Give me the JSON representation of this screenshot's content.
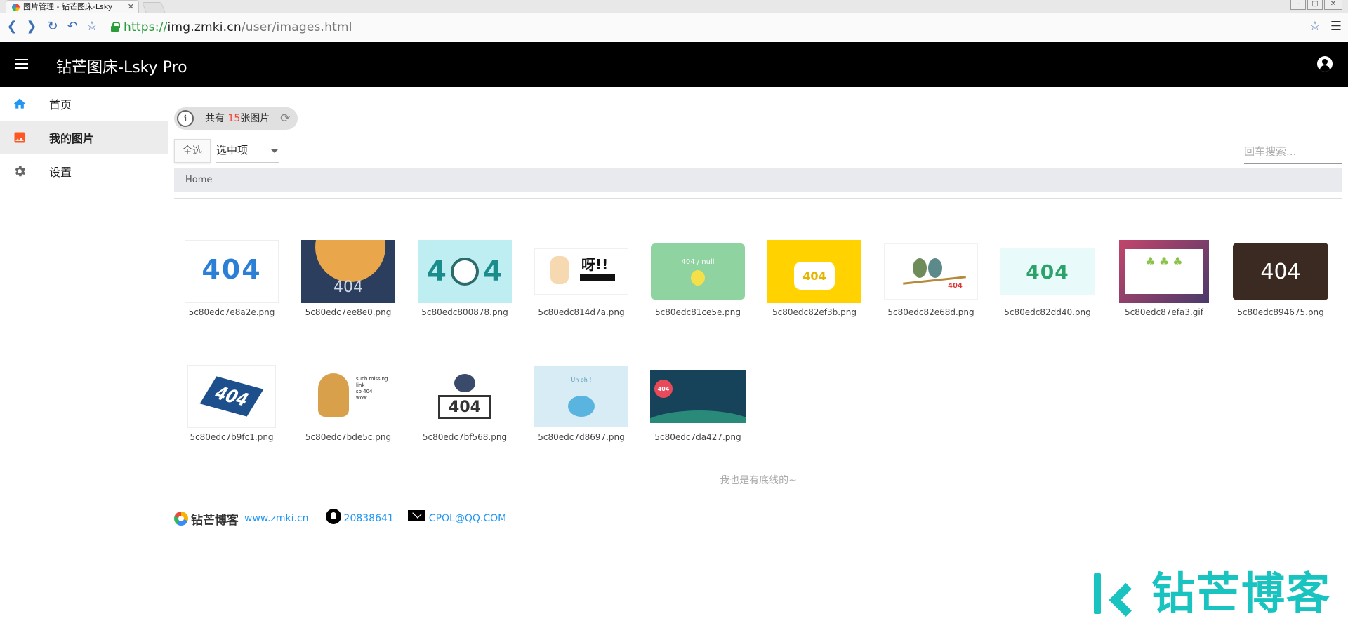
{
  "browser": {
    "tab_title": "图片管理 - 钻芒图床-Lsky",
    "url_scheme": "https://",
    "url_host": "img.zmki.cn",
    "url_path": "/user/images.html"
  },
  "header": {
    "title": "钻芒图床-Lsky Pro"
  },
  "sidebar": {
    "items": [
      {
        "label": "首页",
        "icon": "home-icon",
        "color": "#2196f3"
      },
      {
        "label": "我的图片",
        "icon": "image-icon",
        "color": "#ff5722",
        "active": true
      },
      {
        "label": "设置",
        "icon": "gear-icon",
        "color": "#666666"
      }
    ]
  },
  "toolbar": {
    "count_prefix": "共有",
    "count_value": "15",
    "count_suffix": "张图片",
    "select_all": "全选",
    "selected_action": "选中项",
    "search_placeholder": "回车搜索..."
  },
  "breadcrumb": {
    "home": "Home"
  },
  "images": [
    {
      "name": "5c80edc7e8a2e.png",
      "art": "404 blue"
    },
    {
      "name": "5c80edc7ee8e0.png",
      "art": "planet 404"
    },
    {
      "name": "5c80edc800878.png",
      "art": "4 face 4"
    },
    {
      "name": "5c80edc814d7a.png",
      "art": "呀!! 404"
    },
    {
      "name": "5c80edc81ce5e.png",
      "art": "404 / null"
    },
    {
      "name": "5c80edc82ef3b.png",
      "art": "404 sign"
    },
    {
      "name": "5c80edc82e68d.png",
      "art": "birds 404"
    },
    {
      "name": "5c80edc82dd40.png",
      "art": "404 green"
    },
    {
      "name": "5c80edc87efa3.gif",
      "art": "trees"
    },
    {
      "name": "5c80edc894675.png",
      "art": "404 dark"
    },
    {
      "name": "5c80edc7b9fc1.png",
      "art": "404 tilted"
    },
    {
      "name": "5c80edc7bde5c.png",
      "art": "doge such missing link so 404 wow"
    },
    {
      "name": "5c80edc7bf568.png",
      "art": "boy 404 sign"
    },
    {
      "name": "5c80edc7d8697.png",
      "art": "Uh oh! monster"
    },
    {
      "name": "5c80edc7da427.png",
      "art": "404 road sign"
    }
  ],
  "bottom_note": "我也是有底线的~",
  "footer": {
    "blog_name": "钻芒博客",
    "website": "www.zmki.cn",
    "qq": "20838641",
    "email": "CPOL@QQ.COM"
  },
  "watermark": {
    "text": "钻芒博客",
    "color": "#19c4c0"
  }
}
